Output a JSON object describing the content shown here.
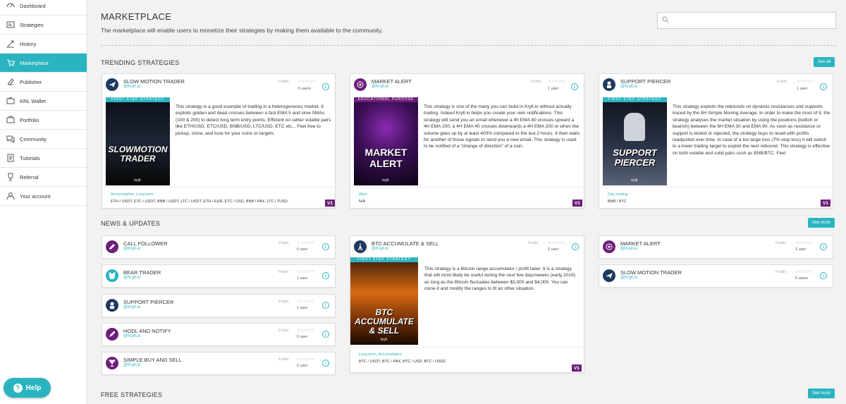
{
  "sidebar": {
    "items": [
      {
        "label": "Dashboard",
        "icon": "dashboard-icon"
      },
      {
        "label": "Strategies",
        "icon": "strategies-icon"
      },
      {
        "label": "History",
        "icon": "history-icon"
      },
      {
        "label": "Marketplace",
        "icon": "marketplace-icon"
      },
      {
        "label": "Publisher",
        "icon": "publisher-icon"
      },
      {
        "label": "KRL Wallet",
        "icon": "wallet-icon"
      },
      {
        "label": "Portfolio",
        "icon": "portfolio-icon"
      },
      {
        "label": "Community",
        "icon": "community-icon"
      },
      {
        "label": "Tutorials",
        "icon": "tutorials-icon"
      },
      {
        "label": "Referral",
        "icon": "referral-icon"
      },
      {
        "label": "Your account",
        "icon": "account-icon"
      }
    ],
    "active": "Marketplace",
    "help_label": "Help"
  },
  "header": {
    "title": "MARKETPLACE",
    "description": "The marketplace will enable users to monetize their strategies by making them available to the community."
  },
  "colors": {
    "accent": "#2ab4c0",
    "badge": "#6d1f7a",
    "logo_dark": "#1f3a5f",
    "logo_purple": "#6d1f7a"
  },
  "sections": {
    "trending": {
      "title": "TRENDING STRATEGIES",
      "button": "See all"
    },
    "news": {
      "title": "NEWS & UPDATES",
      "button": "See more"
    },
    "free": {
      "title": "FREE STRATEGIES",
      "button": "See more"
    }
  },
  "trending": [
    {
      "name": "SLOW MOTION TRADER",
      "author": "@Kryll.io",
      "visibility": "Public",
      "stars": "☆☆☆☆☆",
      "users": "5 users",
      "thumb_banner": "FIRST STEP STRATEGY",
      "thumb_title": "SLOWMOTION TRADER",
      "thumb_brand": "kryll.",
      "description": "This strategy is a good example of trading in a heterogeneous market. It exploits golden and dead crosses between a fast EMA 5 and slow SMAs (100 & 200) to detect long term entry points. Efficient on rather volatile pairs like ETH/USD, ETC/USD, BNB/USD, LTC/USD, ETC etc... Feel free to pickup, clone, and tune for your coins or targets.",
      "tags": "Accumulation, Long term",
      "pairs": "ETH / USDT, ETC / USDT, BNB / USDT, LTC / USDT, ETH / EUR, ETC / USD, BNB / PAX, LTC / TUSD",
      "version": "V1"
    },
    {
      "name": "MARKET ALERT",
      "author": "@Kryll.io",
      "visibility": "Public",
      "stars": "☆☆☆☆☆",
      "users": "1 user",
      "thumb_banner": "EDUCATIONAL PURPOSE",
      "thumb_title": "MARKET ALERT",
      "thumb_brand": "kryll.",
      "description": "This strategy is one of the many you can build in Kryll.io without actually trading. Indeed Kryll.io helps you create your own notifications. This strategy will send you an email whenever a 4h EMA 40 crosses upward a 4H EMA 200, a 4H EMA 40 crosses downwards a 4H EMA 200 or when the volume goes up by at least 400% compared to the last 2 hours. It then waits for another of those signals to send you a new email. This strategy is used to be notified of a \"change of direction\" of a coin.",
      "tags": "Alert",
      "pairs": "N/A",
      "version": "V1"
    },
    {
      "name": "SUPPORT PIERCER",
      "author": "@Kryll.io",
      "visibility": "Public",
      "stars": "☆☆☆☆☆",
      "users": "1 user",
      "thumb_banner": "FIRST STEP STRATEGY",
      "thumb_title": "SUPPORT PIERCER",
      "thumb_brand": "kryll.",
      "description": "This strategy exploits the rebounds on dynamic resistances and supports traced by the 6H Simple Moving Average. In order to make the most of it, the strategy analyses the market situation by using the positions (bullish or bearish) between the 6H EMA 30 and EMA 90. As soon as resistance or support is tested or rejected, the strategy buys to resell with profits readjusted over time. In case of a too large loss (7% stop loss) it will switch to a lower trading target to exploit the next rebound. This strategy is effective on both volatile and solid pairs such as BNB/BTC. Feel",
      "tags": "Day trading",
      "pairs": "BNB / BTC",
      "version": "V1"
    }
  ],
  "news_left": [
    {
      "name": "CALL FOLLOWER",
      "author": "@Kryll.io",
      "visibility": "Public",
      "stars": "☆☆☆☆☆",
      "users": "0 user",
      "icon": "pencil-icon"
    },
    {
      "name": "BEAR TRADER",
      "author": "@Kryll.io",
      "visibility": "Public",
      "stars": "☆☆☆☆☆",
      "users": "1 user",
      "icon": "bear-icon"
    },
    {
      "name": "SUPPORT PIERCER",
      "author": "@Kryll.io",
      "visibility": "Public",
      "stars": "☆☆☆☆☆",
      "users": "1 user",
      "icon": "astronaut-icon"
    },
    {
      "name": "HODL AND NOTIFY",
      "author": "@Kryll.io",
      "visibility": "Public",
      "stars": "☆☆☆☆☆",
      "users": "0 user",
      "icon": "rocket-icon"
    },
    {
      "name": "SIMPLE BUY AND SELL",
      "author": "@Kryll.io",
      "visibility": "Public",
      "stars": "☆☆☆☆☆",
      "users": "0 user",
      "icon": "cocktail-icon"
    }
  ],
  "news_center": {
    "name": "BTC ACCUMULATE & SELL",
    "author": "@Kryll.io",
    "visibility": "Public",
    "stars": "☆☆☆☆☆",
    "users": "0 user",
    "thumb_banner": "FIRST STEP STRATEGY",
    "thumb_title": "BTC ACCUMULATE & SELL",
    "thumb_brand": "kryll.",
    "description": "This strategy is a Bitcoin range accumulator / profit taker. It is a strategy that will most likely be useful during the next few days/weeks (early 2019) as long as the Bitcoin fluctuates between $3,000 and $4,000. You can clone it and modify the ranges to fit an other situation.",
    "tags": "Long term, Accumulation",
    "pairs": "BTC / USDT, BTC / PAX, BTC / USD, BTC / USDC",
    "version": "V1"
  },
  "news_right": [
    {
      "name": "MARKET ALERT",
      "author": "@Kryll.io",
      "visibility": "Public",
      "stars": "☆☆☆☆☆",
      "users": "1 user",
      "icon": "target-icon"
    },
    {
      "name": "SLOW MOTION TRADER",
      "author": "@Kryll.io",
      "visibility": "Public",
      "stars": "☆☆☆☆☆",
      "users": "5 users",
      "icon": "plane-icon"
    }
  ]
}
